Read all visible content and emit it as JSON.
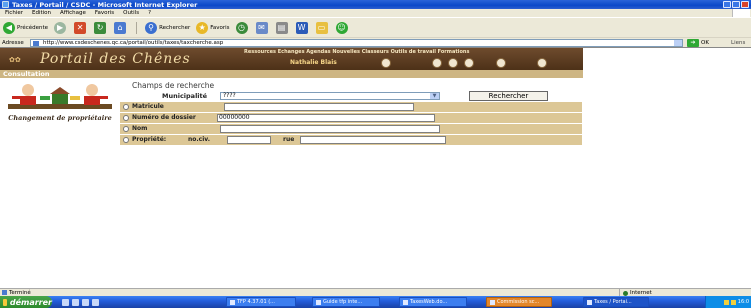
{
  "window": {
    "title": "Taxes / Portail / CSDC - Microsoft Internet Explorer"
  },
  "menu": [
    "Fichier",
    "Edition",
    "Affichage",
    "Favoris",
    "Outils",
    "?"
  ],
  "toolbar": {
    "back_label": "Précédente",
    "search_label": "Rechercher",
    "favorites_label": "Favoris"
  },
  "address": {
    "label": "Adresse",
    "url": "http://www.csdeschenes.qc.ca/portail/outils/taxes/taxcherche.asp",
    "go_label": "OK",
    "links_label": "Liens"
  },
  "portal": {
    "title": "Portail des Chênes",
    "nav": "Ressources  Echanges  Agendas  Nouvelles  Classeurs  Outils de travail  Formations",
    "user": "Nathalie Blais",
    "subheader": "Consultation"
  },
  "sidebar": {
    "caption": "Changement de propriétaire"
  },
  "form": {
    "title": "Champs de recherche",
    "municipality_label": "Municipalité",
    "municipality_value": "????",
    "search_button": "Rechercher",
    "options": {
      "matricule": "Matricule",
      "dossier": "Numéro de dossier",
      "dossier_value": "00000000",
      "nom": "Nom",
      "propriete": "Propriété:",
      "nociv": "no.civ.",
      "rue": "rue"
    }
  },
  "status": {
    "left": "Terminé",
    "zone": "Internet"
  },
  "taskbar": {
    "start": "démarrer",
    "tasks": [
      "TFP 4.37.01 (...",
      "Guide tfp inte...",
      "TaxesWeb.do...",
      "Commission sc...",
      "Taxes / Portai..."
    ],
    "clock": "16:0"
  },
  "colors": {
    "header_brown": "#5a3b20",
    "form_tan": "#dcc796",
    "subheader_tan": "#cdb583"
  }
}
